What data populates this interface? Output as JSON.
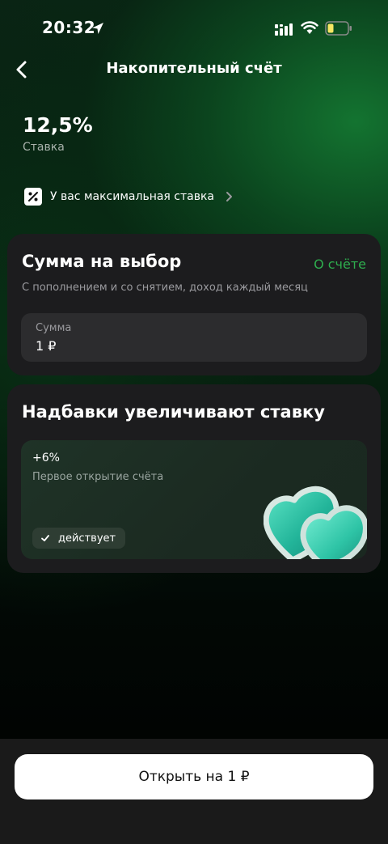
{
  "status_bar": {
    "time": "20:32",
    "icons": [
      "location-arrow-icon",
      "signal-icon",
      "wifi-icon",
      "battery-low-icon"
    ],
    "battery_color": "#f5e663"
  },
  "header": {
    "title": "Накопительный счёт",
    "back_icon": "chevron-left-icon"
  },
  "rate": {
    "value": "12,5%",
    "caption": "Ставка"
  },
  "max_rate": {
    "label": "У вас максимальная ставка",
    "icon": "percent-icon"
  },
  "amount_card": {
    "title": "Сумма на выбор",
    "link": "О счёте",
    "subtitle": "С пополнением и со снятием, доход каждый месяц",
    "field_label": "Сумма",
    "field_value": "1 ₽"
  },
  "bonus_card": {
    "title": "Надбавки увеличивают ставку",
    "bonus": {
      "value": "+6%",
      "description": "Первое открытие счёта",
      "status": "действует"
    }
  },
  "cta": {
    "label": "Открыть на 1 ₽"
  },
  "colors": {
    "accent_green": "#2eae4e",
    "card_bg": "#1c1c1e",
    "field_bg": "#2c2c2e"
  }
}
